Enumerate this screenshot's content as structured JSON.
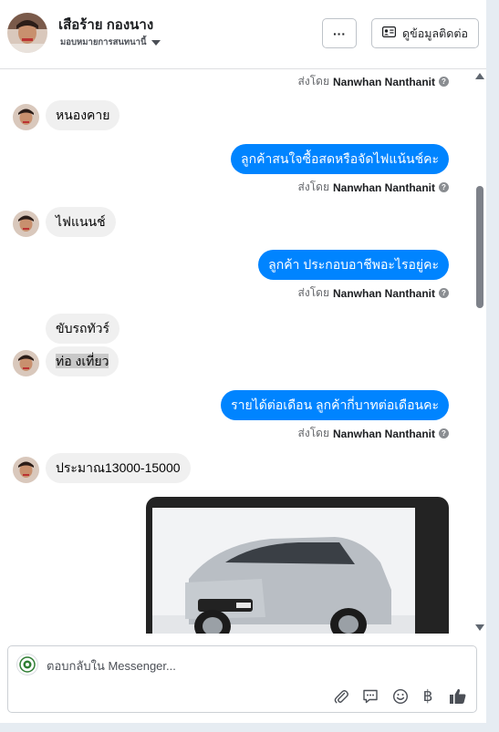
{
  "header": {
    "contact_name": "เสือร้าย กองนาง",
    "assign_label": "มอบหมายการสนทนานี้",
    "more_label": "···",
    "contact_info_label": "ดูข้อมูลติดต่อ"
  },
  "colors": {
    "outgoing_bubble": "#0084ff",
    "incoming_bubble": "#f0f0f0",
    "like_icon": "#4b4f56"
  },
  "messages": [
    {
      "type": "sent_by",
      "prefix": "ส่งโดย",
      "name": "Nanwhan Nanthanit"
    },
    {
      "type": "incoming",
      "text": "หนองคาย"
    },
    {
      "type": "outgoing",
      "text": "ลูกค้าสนใจซื้อสดหรือจัดไฟแน้นช์คะ"
    },
    {
      "type": "sent_by",
      "prefix": "ส่งโดย",
      "name": "Nanwhan Nanthanit"
    },
    {
      "type": "incoming",
      "text": "ไฟแนนช์"
    },
    {
      "type": "outgoing",
      "text": "ลูกค้า ประกอบอาชีพอะไรอยู่คะ"
    },
    {
      "type": "sent_by",
      "prefix": "ส่งโดย",
      "name": "Nanwhan Nanthanit"
    },
    {
      "type": "incoming",
      "text": "ขับรถทัวร์"
    },
    {
      "type": "incoming",
      "text": "ท่อ งเที่ยว"
    },
    {
      "type": "outgoing",
      "text": "รายได้ต่อเดือน ลูกค้ากี่บาทต่อเดือนคะ"
    },
    {
      "type": "sent_by",
      "prefix": "ส่งโดย",
      "name": "Nanwhan Nanthanit"
    },
    {
      "type": "incoming",
      "text": "ประมาณ13000-15000"
    },
    {
      "type": "photo",
      "subject": "silver-toyota-hatchback"
    }
  ],
  "composer": {
    "placeholder": "ตอบกลับใน Messenger...",
    "value": ""
  },
  "toolbar_icons": [
    "paperclip-icon",
    "saved-reply-icon",
    "emoji-icon",
    "currency-baht-icon",
    "thumbs-up-icon"
  ],
  "toolbar": {
    "baht_symbol": "฿"
  }
}
